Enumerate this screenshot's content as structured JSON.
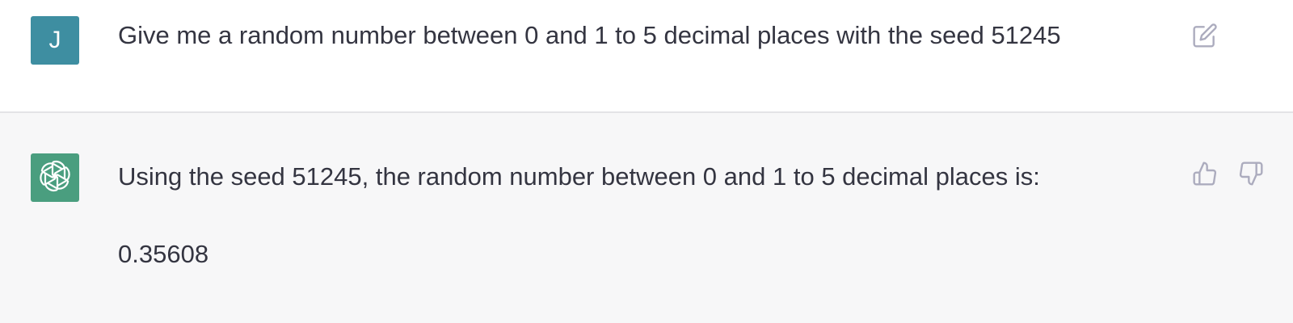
{
  "conversation": {
    "user_message": {
      "avatar_letter": "J",
      "text": "Give me a random number between 0 and 1 to 5 decimal places with the seed 51245",
      "action_icon": "edit-icon"
    },
    "assistant_message": {
      "avatar_icon": "openai-logo-icon",
      "line1": "Using the seed 51245, the random number between 0 and 1 to 5 decimal places is:",
      "line2": "0.35608",
      "action_icons": [
        "thumbs-up-icon",
        "thumbs-down-icon"
      ]
    }
  },
  "colors": {
    "user_avatar_bg": "#3e8ea1",
    "assistant_avatar_bg": "#4a9e7f",
    "assistant_row_bg": "#f7f7f8",
    "text": "#343541",
    "icon": "#acacbe"
  }
}
